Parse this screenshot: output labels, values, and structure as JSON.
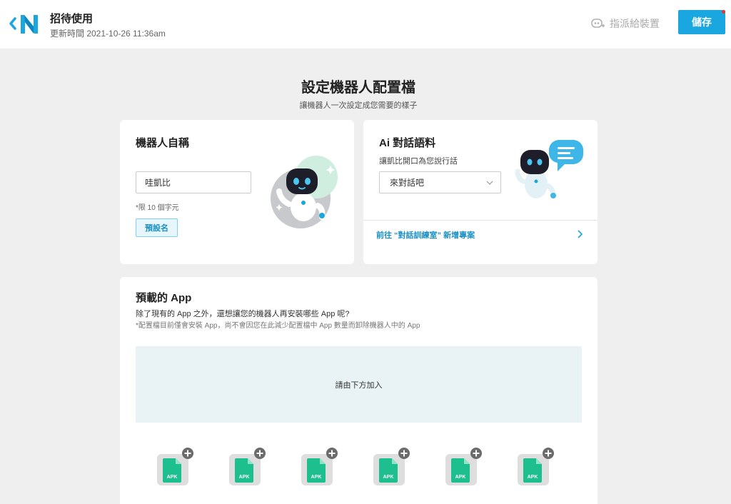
{
  "header": {
    "title": "招待使用",
    "updated": "更新時間 2021-10-26 11:36am",
    "assign_label": "指派給裝置",
    "save_label": "儲存"
  },
  "page": {
    "title": "設定機器人配置檔",
    "subtitle": "讓機器人一次設定成您需要的樣子"
  },
  "name_card": {
    "title": "機器人自稱",
    "input_value": "哇凱比",
    "hint": "*限 10 個字元",
    "default_button": "預設名"
  },
  "ai_card": {
    "title": "Ai 對話語料",
    "desc": "讓凱比開口為您說行話",
    "select_value": "來對話吧",
    "link": "前往 “對話訓練室” 新增專案"
  },
  "app_card": {
    "title": "預載的 App",
    "desc1": "除了現有的 App 之外，還想讓您的機器人再安裝哪些 App 呢?",
    "desc2": "*配置檔目前僅會安裝 App，尚不會因您在此減少配置檔中 App 數量而卸除機器人中的 App",
    "dropzone": "請由下方加入",
    "apk_label": "APK"
  },
  "colors": {
    "accent": "#1aa7e0",
    "apk_green": "#1dbf8e",
    "dropzone_bg": "#e9f3f5"
  }
}
